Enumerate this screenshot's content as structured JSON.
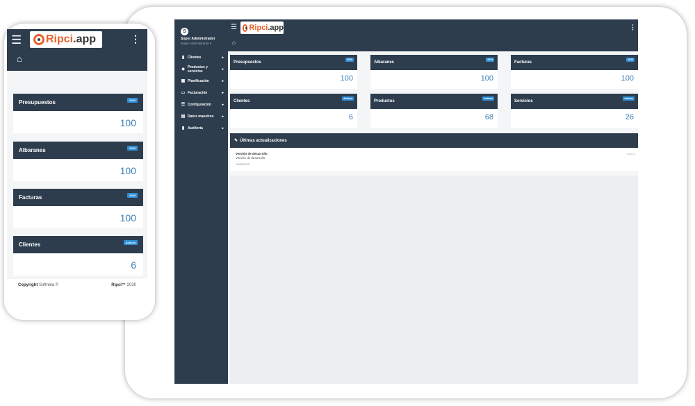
{
  "brand": {
    "logo_main": "Ripci",
    "logo_ext": ".app"
  },
  "colors": {
    "primary": "#2d3d4e",
    "accent": "#2f8fd6",
    "value": "#3e7fb8",
    "logo": "#e8622a"
  },
  "user": {
    "avatar_letter": "S",
    "name": "Super Administrador",
    "role": "Super Administrador ▾"
  },
  "sidebar": {
    "items": [
      {
        "icon": "document-icon",
        "glyph": "▮",
        "label": "Clientes"
      },
      {
        "icon": "tag-icon",
        "glyph": "◆",
        "label": "Productos y servicios"
      },
      {
        "icon": "calendar-icon",
        "glyph": "▦",
        "label": "Planificación"
      },
      {
        "icon": "money-icon",
        "glyph": "▭",
        "label": "Facturación"
      },
      {
        "icon": "sliders-icon",
        "glyph": "☰",
        "label": "Configuración"
      },
      {
        "icon": "table-icon",
        "glyph": "▤",
        "label": "Datos maestros"
      },
      {
        "icon": "book-icon",
        "glyph": "▮",
        "label": "Auditoria"
      }
    ]
  },
  "dashboard": {
    "cards": [
      {
        "title": "Presupuestos",
        "badge": "2020",
        "value": "100"
      },
      {
        "title": "Albaranes",
        "badge": "2020",
        "value": "100"
      },
      {
        "title": "Facturas",
        "badge": "2020",
        "value": "100"
      },
      {
        "title": "Clientes",
        "badge": "Activos",
        "value": "6"
      },
      {
        "title": "Productos",
        "badge": "Activos",
        "value": "68"
      },
      {
        "title": "Servicios",
        "badge": "Activos",
        "value": "26"
      }
    ]
  },
  "updates": {
    "title": "Últimas actualizaciones",
    "entry": {
      "title": "Versión de desarrollo",
      "description": "Versión de desarrollo",
      "date": "19/05/2020",
      "version": "v.0.0.1"
    }
  },
  "phone": {
    "cards": [
      {
        "title": "Presupuestos",
        "badge": "2020",
        "value": "100"
      },
      {
        "title": "Albaranes",
        "badge": "2020",
        "value": "100"
      },
      {
        "title": "Facturas",
        "badge": "2020",
        "value": "100"
      },
      {
        "title": "Clientes",
        "badge": "Activos",
        "value": "6"
      }
    ],
    "footer": {
      "copyright_label": "Copyright",
      "copyright_owner": "Softnela ©",
      "app_label": "Ripci™",
      "year": "2020"
    }
  }
}
